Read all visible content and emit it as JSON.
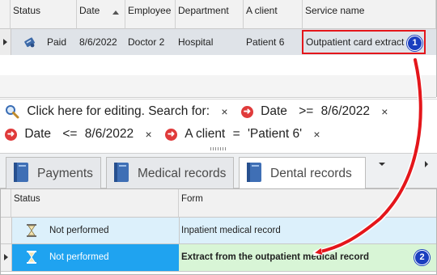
{
  "top_grid": {
    "columns": [
      "Status",
      "Date",
      "Employee",
      "Department",
      "A client",
      "Service name"
    ],
    "row": {
      "status": "Paid",
      "date": "8/6/2022",
      "employee": "Doctor 2",
      "department": "Hospital",
      "client": "Patient 6",
      "service": "Outpatient card extract"
    },
    "marker": "1"
  },
  "filter": {
    "hint": "Click here for editing. Search for:",
    "conditions": [
      {
        "field": "Date",
        "op": ">=",
        "value": "8/6/2022"
      },
      {
        "field": "Date",
        "op": "<=",
        "value": "8/6/2022"
      },
      {
        "field": "A client",
        "op": "=",
        "value": "'Patient 6'"
      }
    ],
    "remove_glyph": "×"
  },
  "tabs": [
    {
      "label": "Payments",
      "active": false
    },
    {
      "label": "Medical records",
      "active": false
    },
    {
      "label": "Dental records",
      "active": true
    }
  ],
  "bottom_grid": {
    "columns": [
      "Status",
      "Form"
    ],
    "rows": [
      {
        "status": "Not performed",
        "form": "Inpatient medical record"
      },
      {
        "status": "Not performed",
        "form": "Extract from the outpatient medical record"
      }
    ],
    "marker": "2"
  },
  "colors": {
    "highlight_red": "#e4161b",
    "marker_blue": "#1b3fbf",
    "selected_blue": "#1fa3f0",
    "row_light_blue": "#dcf0fb",
    "row_light_green": "#d8f5d6"
  },
  "icons": [
    "medical-card-icon",
    "search-icon",
    "red-arrow-icon",
    "book-icon",
    "hourglass-icon",
    "row-indicator-icon",
    "dropdown-arrow-icon",
    "scroll-right-icon"
  ]
}
